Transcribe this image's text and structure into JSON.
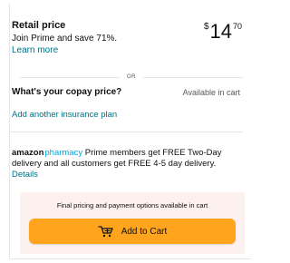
{
  "retail": {
    "title": "Retail price",
    "subtitle": "Join Prime and save 71%.",
    "learn_more": "Learn more",
    "price": {
      "symbol": "$",
      "whole": "14",
      "fraction": "70"
    }
  },
  "separator": {
    "text": "OR"
  },
  "copay": {
    "title": "What's your copay price?",
    "availability": "Available in cart",
    "add_insurance": "Add another insurance plan"
  },
  "pharmacy": {
    "logo_word1": "amazon",
    "logo_word2": "pharmacy",
    "message": "Prime members get FREE Two-Day delivery and all customers get FREE 4-5 day delivery.",
    "details_link": "Details"
  },
  "cart_panel": {
    "note": "Final pricing and payment options available in cart",
    "add_to_cart": "Add to Cart"
  },
  "colors": {
    "link": "#007185",
    "button": "#ffa41c",
    "panel_bg": "#fcf1ee",
    "pharmacy_blue": "#00a8e1"
  },
  "icons": {
    "cart": "cart-icon"
  }
}
